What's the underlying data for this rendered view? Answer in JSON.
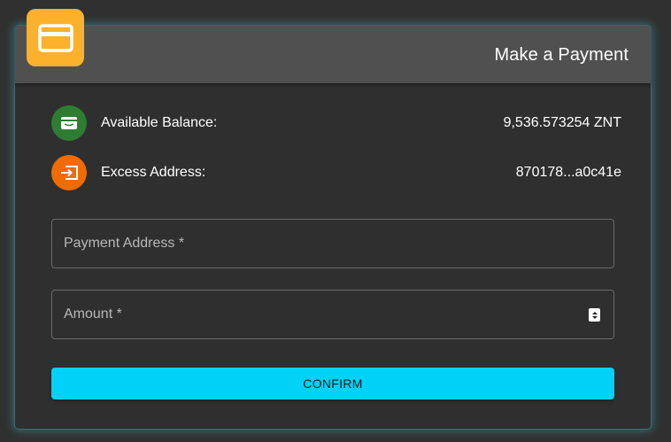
{
  "header": {
    "title": "Make a Payment",
    "badge_icon": "credit-card-icon",
    "badge_color": "#fbb12b"
  },
  "balance": {
    "label": "Available Balance:",
    "value": "9,536.573254 ZNT",
    "icon": "wallet-icon",
    "icon_color": "#2e7d32"
  },
  "excess": {
    "label": "Excess Address:",
    "value": "870178...a0c41e",
    "icon": "input-arrow-icon",
    "icon_color": "#ef6c00"
  },
  "form": {
    "payment_address": {
      "placeholder": "Payment Address *",
      "value": ""
    },
    "amount": {
      "placeholder": "Amount *",
      "value": ""
    },
    "confirm_label": "CONFIRM",
    "confirm_color": "#00d2f7"
  },
  "colors": {
    "background": "#303030",
    "header_background": "#505050",
    "card_glow": "#50bec8"
  }
}
